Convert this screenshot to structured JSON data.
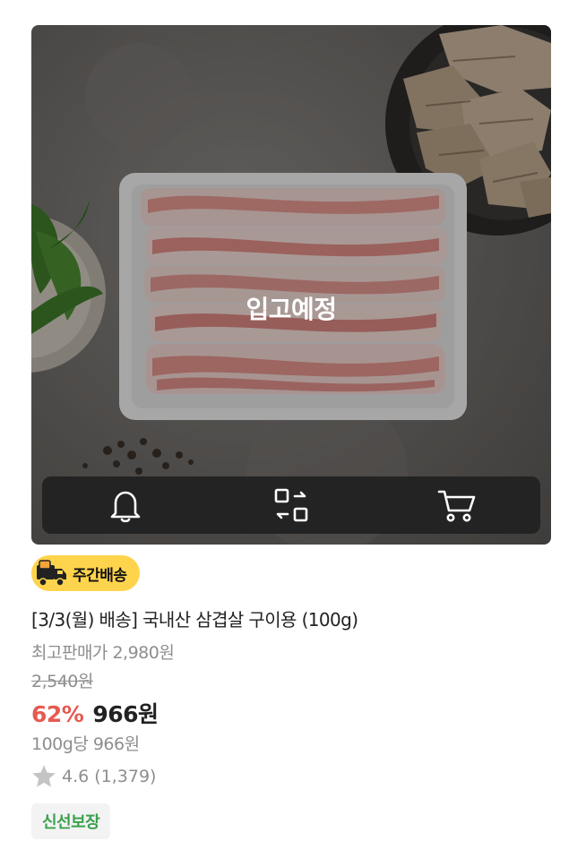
{
  "product": {
    "status_overlay": "입고예정",
    "delivery_badge": "주간배송",
    "title": "[3/3(월) 배송] 국내산 삼겹살 구이용 (100g)",
    "highest_price": "최고판매가 2,980원",
    "original_price": "2,540원",
    "discount": "62%",
    "sale_price": "966원",
    "unit_price": "100g당 966원",
    "rating": "4.6 (1,379)",
    "fresh_badge": "신선보장"
  },
  "actions": [
    {
      "name": "bell-icon"
    },
    {
      "name": "compare-icon"
    },
    {
      "name": "cart-icon"
    }
  ],
  "colors": {
    "discount": "#e65a4f",
    "badge_yellow": "#ffd44d",
    "fresh_green": "#3aa14d",
    "action_bar": "#232323"
  }
}
